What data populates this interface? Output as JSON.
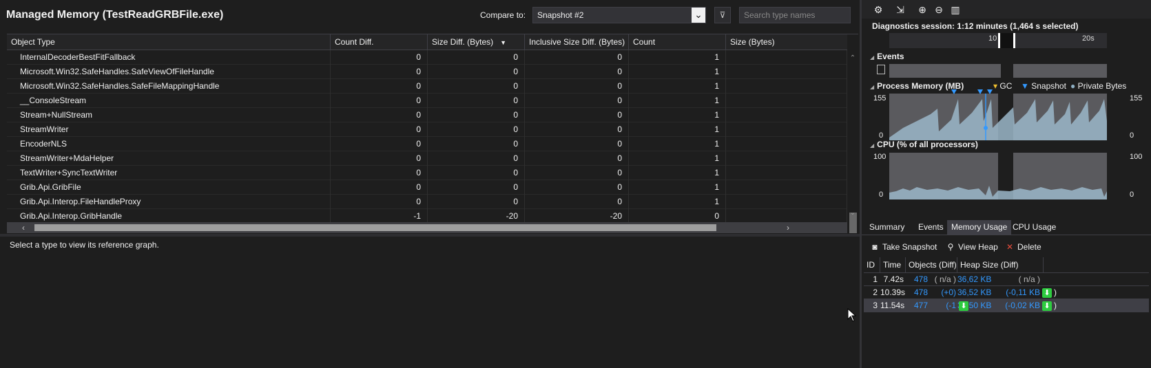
{
  "title": "Managed Memory (TestReadGRBFile.exe)",
  "compare": {
    "label": "Compare to:",
    "value": "Snapshot #2"
  },
  "search": {
    "placeholder": "Search type names"
  },
  "grid": {
    "columns": [
      "Object Type",
      "Count Diff.",
      "Size Diff. (Bytes)",
      "Inclusive Size Diff. (Bytes)",
      "Count",
      "Size (Bytes)"
    ],
    "rows": [
      {
        "name": "InternalDecoderBestFitFallback",
        "count_diff": "0",
        "size_diff": "0",
        "incl_diff": "0",
        "count": "1",
        "size": ""
      },
      {
        "name": "Microsoft.Win32.SafeHandles.SafeViewOfFileHandle",
        "count_diff": "0",
        "size_diff": "0",
        "incl_diff": "0",
        "count": "1",
        "size": ""
      },
      {
        "name": "Microsoft.Win32.SafeHandles.SafeFileMappingHandle",
        "count_diff": "0",
        "size_diff": "0",
        "incl_diff": "0",
        "count": "1",
        "size": ""
      },
      {
        "name": "__ConsoleStream",
        "count_diff": "0",
        "size_diff": "0",
        "incl_diff": "0",
        "count": "1",
        "size": ""
      },
      {
        "name": "Stream+NullStream",
        "count_diff": "0",
        "size_diff": "0",
        "incl_diff": "0",
        "count": "1",
        "size": ""
      },
      {
        "name": "StreamWriter",
        "count_diff": "0",
        "size_diff": "0",
        "incl_diff": "0",
        "count": "1",
        "size": ""
      },
      {
        "name": "EncoderNLS",
        "count_diff": "0",
        "size_diff": "0",
        "incl_diff": "0",
        "count": "1",
        "size": ""
      },
      {
        "name": "StreamWriter+MdaHelper",
        "count_diff": "0",
        "size_diff": "0",
        "incl_diff": "0",
        "count": "1",
        "size": ""
      },
      {
        "name": "TextWriter+SyncTextWriter",
        "count_diff": "0",
        "size_diff": "0",
        "incl_diff": "0",
        "count": "1",
        "size": ""
      },
      {
        "name": "Grib.Api.GribFile",
        "count_diff": "0",
        "size_diff": "0",
        "incl_diff": "0",
        "count": "1",
        "size": ""
      },
      {
        "name": "Grib.Api.Interop.FileHandleProxy",
        "count_diff": "0",
        "size_diff": "0",
        "incl_diff": "0",
        "count": "1",
        "size": ""
      },
      {
        "name": "Grib.Api.Interop.GribHandle",
        "count_diff": "-1",
        "size_diff": "-20",
        "incl_diff": "-20",
        "count": "0",
        "size": ""
      }
    ]
  },
  "reference_hint": "Select a type to view its reference graph.",
  "diagnostics": {
    "session": "Diagnostics session: 1:12 minutes (1,464 s selected)",
    "ruler_ticks": [
      "10",
      "20s"
    ],
    "events_title": "Events",
    "memory_title": "Process Memory (MB)",
    "legend": {
      "gc": "GC",
      "snapshot": "Snapshot",
      "private": "Private Bytes"
    },
    "memory_axis": {
      "max": "155",
      "min": "0"
    },
    "cpu_title": "CPU (% of all processors)",
    "cpu_axis": {
      "max": "100",
      "min": "0"
    },
    "colors": {
      "chart_bg": "#5a5a5e",
      "fill": "#9bb7c9",
      "snapshot": "#3399ff",
      "gc": "#f0c030"
    }
  },
  "tabs": [
    "Summary",
    "Events",
    "Memory Usage",
    "CPU Usage"
  ],
  "active_tab": "Memory Usage",
  "snapshot_actions": {
    "take": "Take Snapshot",
    "view": "View Heap",
    "delete": "Delete"
  },
  "snapshots": {
    "headers": [
      "ID",
      "Time",
      "Objects (Diff)",
      "Heap Size (Diff)"
    ],
    "rows": [
      {
        "id": "1",
        "time": "7.42s",
        "objects": "478",
        "objects_diff": "( n/a )",
        "heap": "36,62 KB",
        "heap_diff": "( n/a )"
      },
      {
        "id": "2",
        "time": "10.39s",
        "objects": "478",
        "objects_diff": "(+0)",
        "heap": "36,52 KB",
        "heap_diff": "(-0,11 KB"
      },
      {
        "id": "3",
        "time": "11.54s",
        "objects": "477",
        "objects_diff": "(-1",
        "heap": "36,50 KB",
        "heap_diff": "(-0,02 KB"
      }
    ]
  }
}
